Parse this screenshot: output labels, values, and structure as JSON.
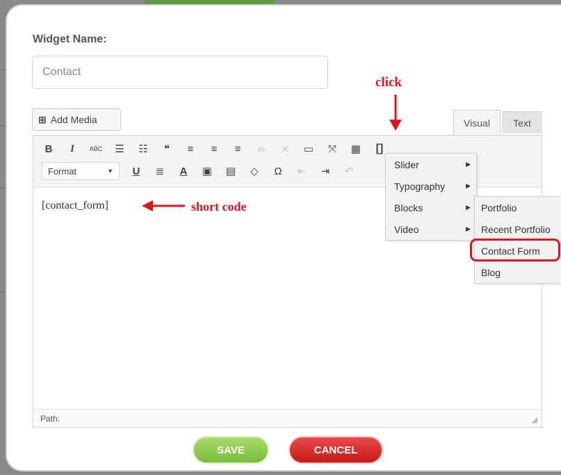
{
  "widget": {
    "name_label": "Widget Name:",
    "name_value": "Contact"
  },
  "media": {
    "add_media_label": "Add Media"
  },
  "tabs": {
    "visual": "Visual",
    "text": "Text"
  },
  "toolbar": {
    "row1": [
      {
        "name": "bold-icon",
        "glyph": "B"
      },
      {
        "name": "italic-icon",
        "glyph": "I"
      },
      {
        "name": "strikethrough-icon",
        "glyph": "ABC"
      },
      {
        "name": "bullet-list-icon",
        "glyph": "☰"
      },
      {
        "name": "numbered-list-icon",
        "glyph": "☷"
      },
      {
        "name": "blockquote-icon",
        "glyph": "❝"
      },
      {
        "name": "align-left-icon",
        "glyph": "≡"
      },
      {
        "name": "align-center-icon",
        "glyph": "≡"
      },
      {
        "name": "align-right-icon",
        "glyph": "≡"
      },
      {
        "name": "link-icon",
        "glyph": "∞"
      },
      {
        "name": "unlink-icon",
        "glyph": "⨯"
      },
      {
        "name": "read-more-icon",
        "glyph": "▭"
      },
      {
        "name": "fullscreen-icon",
        "glyph": "⤧"
      },
      {
        "name": "toolbar-toggle-icon",
        "glyph": "▦"
      },
      {
        "name": "shortcode-icon",
        "glyph": "[]"
      }
    ],
    "format_label": "Format",
    "row2": [
      {
        "name": "underline-icon",
        "glyph": "U"
      },
      {
        "name": "justify-icon",
        "glyph": "≣"
      },
      {
        "name": "text-color-icon",
        "glyph": "A"
      },
      {
        "name": "paste-text-icon",
        "glyph": "▣"
      },
      {
        "name": "paste-word-icon",
        "glyph": "▤"
      },
      {
        "name": "clear-formatting-icon",
        "glyph": "◇"
      },
      {
        "name": "special-character-icon",
        "glyph": "Ω"
      },
      {
        "name": "outdent-icon",
        "glyph": "⇤"
      },
      {
        "name": "indent-icon",
        "glyph": "⇥"
      },
      {
        "name": "undo-icon",
        "glyph": "↶"
      }
    ]
  },
  "editor": {
    "content": "[contact_form]",
    "path_label": "Path:"
  },
  "annotations": {
    "click": "click",
    "short_code": "short code"
  },
  "shortcode_menu": {
    "items": [
      "Slider",
      "Typography",
      "Blocks",
      "Video"
    ],
    "blocks_submenu": [
      "Portfolio",
      "Recent Portfolio",
      "Contact Form",
      "Blog"
    ]
  },
  "buttons": {
    "save": "SAVE",
    "cancel": "CANCEL"
  },
  "colors": {
    "annotation_red": "#e3131b",
    "save_green": "#78bc3a",
    "cancel_red": "#c81717"
  }
}
